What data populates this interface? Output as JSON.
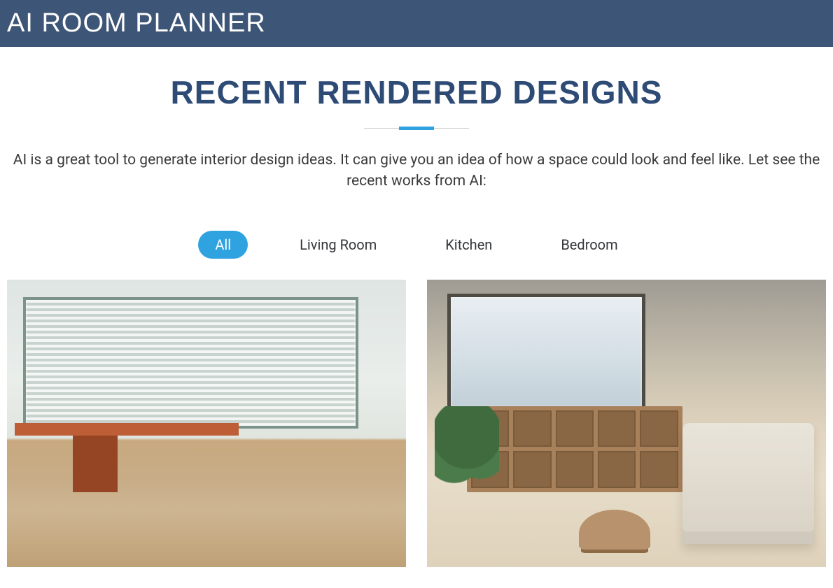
{
  "header": {
    "title": "AI ROOM PLANNER"
  },
  "section": {
    "title": "RECENT RENDERED DESIGNS",
    "intro": "AI is a great tool to generate interior design ideas. It can give you an idea of how a space could look and feel like. Let see the recent works from AI:"
  },
  "filters": {
    "items": [
      {
        "label": "All",
        "active": true
      },
      {
        "label": "Living Room",
        "active": false
      },
      {
        "label": "Kitchen",
        "active": false
      },
      {
        "label": "Bedroom",
        "active": false
      }
    ]
  },
  "gallery": {
    "items": [
      {
        "alt": "Room with large windows, houseplants on wooden desk, light wood floor"
      },
      {
        "alt": "Cozy living room with wooden shelving, plants, light sofa and round tables"
      }
    ]
  }
}
